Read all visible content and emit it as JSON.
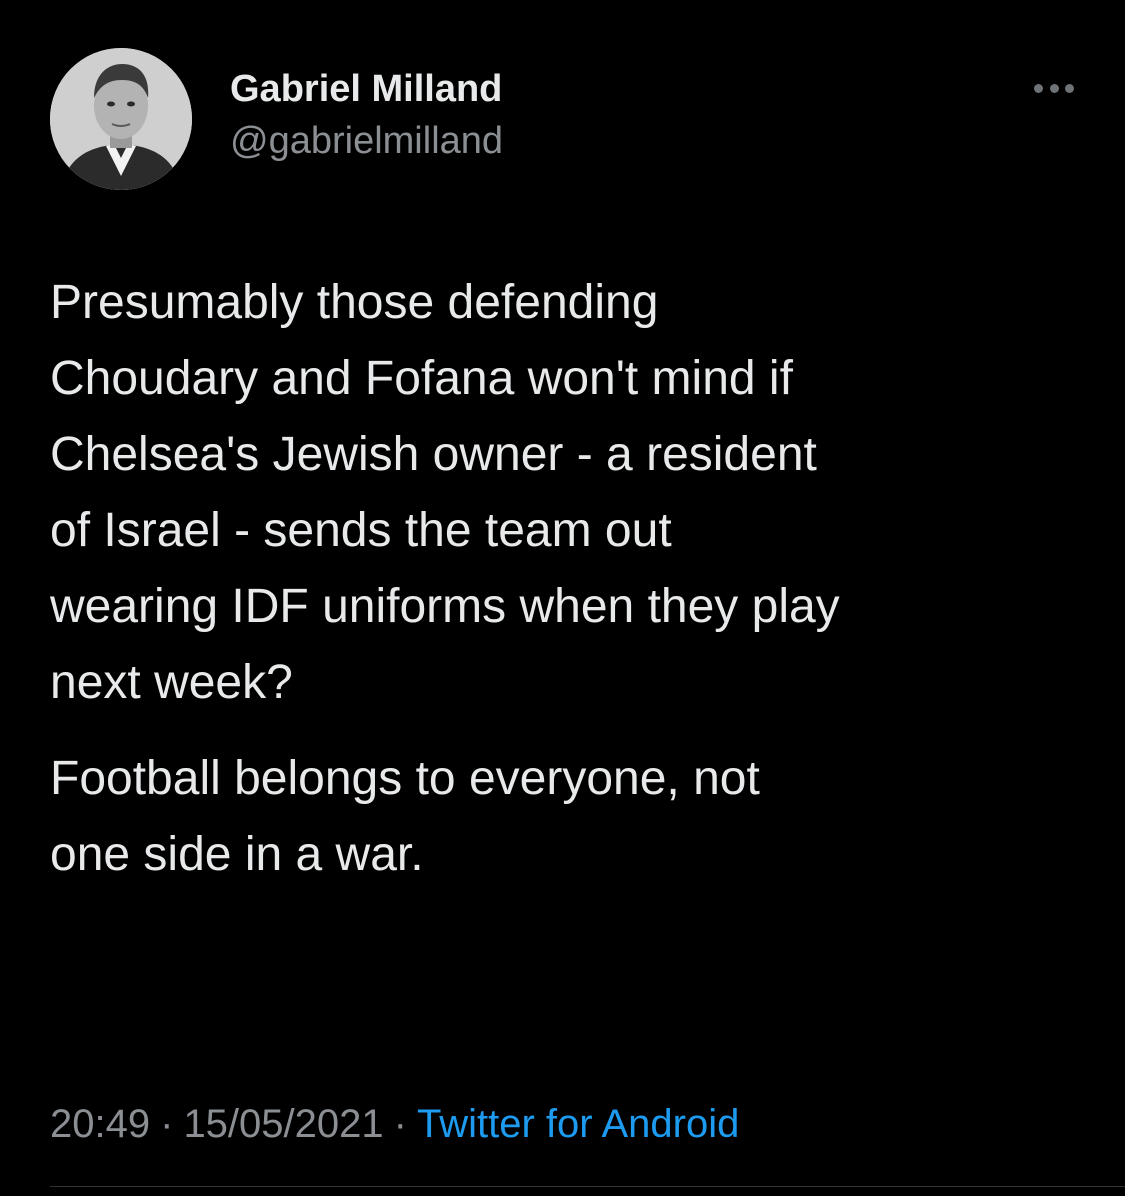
{
  "tweet": {
    "author": {
      "display_name": "Gabriel Milland",
      "handle": "@gabrielmilland"
    },
    "more_icon": "more-horizontal-icon",
    "paragraphs": [
      "Presumably those defending\nChoudary and Fofana won't mind if\nChelsea's Jewish owner - a resident\nof Israel - sends the team out\nwearing IDF uniforms when they play\nnext week?",
      "Football belongs to everyone, not\none side in a war."
    ],
    "time": "20:49",
    "date": "15/05/2021",
    "separator": "·",
    "source": "Twitter for Android"
  },
  "colors": {
    "background": "#000000",
    "text": "#e7e9ea",
    "muted": "#8b8f94",
    "link": "#1d9bf0"
  }
}
